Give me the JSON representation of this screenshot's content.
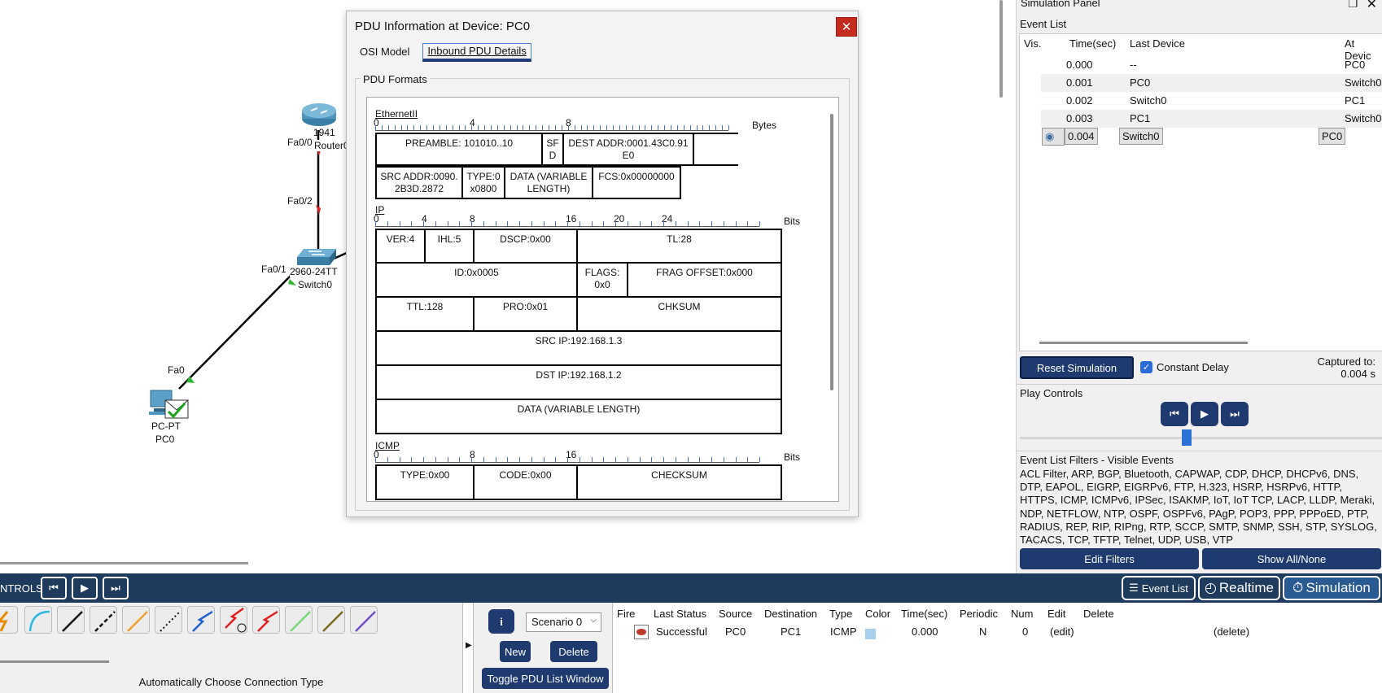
{
  "workspace": {
    "router": {
      "model": "1941",
      "name": "Router0",
      "port_top": "Fa0/0",
      "port_bottom": "Fa0/2"
    },
    "switch": {
      "model": "2960-24TT",
      "name": "Switch0",
      "port_pc": "Fa0/1"
    },
    "pc": {
      "model": "PC-PT",
      "name": "PC0",
      "port": "Fa0"
    }
  },
  "pdu_dialog": {
    "title": "PDU Information at Device: PC0",
    "close": "✕",
    "tabs": [
      "OSI Model",
      "Inbound PDU Details"
    ],
    "formats_label": "PDU Formats",
    "ethernet": {
      "title": "EthernetII",
      "ruler_nums": [
        "0",
        "4",
        "8"
      ],
      "unit": "Bytes",
      "fields": [
        "PREAMBLE: 101010..10",
        "SF D",
        "DEST ADDR:0001.43C0.91 E0",
        "",
        "SRC ADDR:0090. 2B3D.2872",
        "TYPE:0 x0800",
        "DATA (VARIABLE LENGTH)",
        "FCS:0x00000000"
      ]
    },
    "ip": {
      "title": "IP",
      "ruler_nums": [
        "0",
        "4",
        "8",
        "16",
        "20",
        "24"
      ],
      "unit": "Bits",
      "fields": [
        "VER:4",
        "IHL:5",
        "DSCP:0x00",
        "TL:28",
        "ID:0x0005",
        "FLAGS: 0x0",
        "FRAG OFFSET:0x000",
        "TTL:128",
        "PRO:0x01",
        "CHKSUM",
        "SRC IP:192.168.1.3",
        "DST IP:192.168.1.2",
        "DATA (VARIABLE LENGTH)"
      ]
    },
    "icmp": {
      "title": "ICMP",
      "ruler_nums": [
        "0",
        "8",
        "16"
      ],
      "unit": "Bits",
      "fields": [
        "TYPE:0x00",
        "CODE:0x00",
        "CHECKSUM"
      ]
    }
  },
  "sim_panel": {
    "title": "Simulation Panel",
    "event_list_title": "Event List",
    "columns": [
      "Vis.",
      "Time(sec)",
      "Last Device",
      "At Devic"
    ],
    "events": [
      {
        "time": "0.000",
        "last": "--",
        "at": "PC0"
      },
      {
        "time": "0.001",
        "last": "PC0",
        "at": "Switch0"
      },
      {
        "time": "0.002",
        "last": "Switch0",
        "at": "PC1"
      },
      {
        "time": "0.003",
        "last": "PC1",
        "at": "Switch0"
      },
      {
        "time": "0.004",
        "last": "Switch0",
        "at": "PC0"
      }
    ],
    "reset_label": "Reset Simulation",
    "constant_delay_label": "Constant Delay",
    "captured_label": "Captured to:",
    "captured_value": "0.004 s",
    "play_controls_title": "Play Controls",
    "play_progress": 0.46,
    "filters_title": "Event List Filters - Visible Events",
    "filters_text": "ACL Filter, ARP, BGP, Bluetooth, CAPWAP, CDP, DHCP, DHCPv6, DNS, DTP, EAPOL, EIGRP, EIGRPv6, FTP, H.323, HSRP, HSRPv6, HTTP, HTTPS, ICMP, ICMPv6, IPSec, ISAKMP, IoT, IoT TCP, LACP, LLDP, Meraki, NDP, NETFLOW, NTP, OSPF, OSPFv6, PAgP, POP3, PPP, PPPoED, PTP, RADIUS, REP, RIP, RIPng, RTP, SCCP, SMTP, SNMP, SSH, STP, SYSLOG, TACACS, TCP, TFTP, Telnet, UDP, USB, VTP",
    "edit_filters_label": "Edit Filters",
    "show_all_label": "Show All/None"
  },
  "bottom_bar": {
    "controls_label": "NTROLS:",
    "event_list_label": "Event List",
    "realtime_label": "Realtime",
    "simulation_label": "Simulation"
  },
  "connections": {
    "description": "Automatically Choose Connection Type"
  },
  "scenario": {
    "info_label": "i",
    "selected": "Scenario 0",
    "new_label": "New",
    "delete_label": "Delete",
    "toggle_label": "Toggle PDU List Window"
  },
  "pdu_list": {
    "columns": [
      "Fire",
      "Last Status",
      "Source",
      "Destination",
      "Type",
      "Color",
      "Time(sec)",
      "Periodic",
      "Num",
      "Edit",
      "Delete"
    ],
    "rows": [
      {
        "status": "Successful",
        "source": "PC0",
        "destination": "PC1",
        "type": "ICMP",
        "color": "#a7cfee",
        "time": "0.000",
        "periodic": "N",
        "num": "0",
        "edit": "(edit)",
        "delete": "(delete)"
      }
    ]
  }
}
